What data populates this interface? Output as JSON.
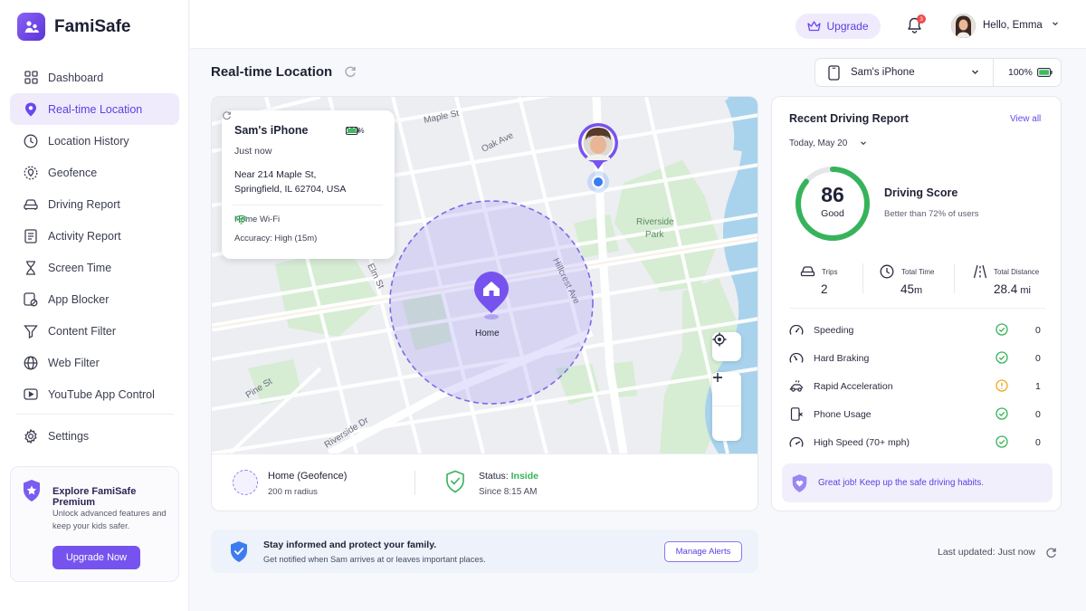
{
  "app": {
    "name": "FamiSafe"
  },
  "sidebar": {
    "items": [
      {
        "label": "Dashboard",
        "icon": "grid-icon"
      },
      {
        "label": "Real-time Location",
        "icon": "location-pin-icon",
        "active": true
      },
      {
        "label": "Location History",
        "icon": "clock-icon"
      },
      {
        "label": "Geofence",
        "icon": "geofence-icon"
      },
      {
        "label": "Driving Report",
        "icon": "car-icon"
      },
      {
        "label": "Activity Report",
        "icon": "report-icon"
      },
      {
        "label": "Screen Time",
        "icon": "hourglass-icon"
      },
      {
        "label": "App Blocker",
        "icon": "app-blocker-icon"
      },
      {
        "label": "Content Filter",
        "icon": "filter-icon"
      },
      {
        "label": "Web Filter",
        "icon": "globe-icon"
      },
      {
        "label": "YouTube App Control",
        "icon": "youtube-icon"
      }
    ],
    "settings_label": "Settings",
    "promo": {
      "title": "Explore FamiSafe Premium",
      "text": "Unlock advanced features and keep your kids safer.",
      "button": "Upgrade Now"
    }
  },
  "header": {
    "upgrade_label": "Upgrade",
    "notification_count": "3",
    "greeting": "Hello, Emma"
  },
  "page": {
    "title": "Real-time Location"
  },
  "device": {
    "name": "Sam's iPhone",
    "battery": "100%"
  },
  "info_card": {
    "device": "Sam's iPhone",
    "battery": "100%",
    "time": "Just now",
    "address_line1": "Near 214 Maple St,",
    "address_line2": "Springfield, IL 62704, USA",
    "wifi": "Home Wi-Fi",
    "accuracy": "Accuracy: High (15m)"
  },
  "map": {
    "streets": [
      "Maple St",
      "Oak Ave",
      "Elm St",
      "Hillcrest Ave",
      "Pine St",
      "Riverside Dr"
    ],
    "park": [
      "Riverside",
      "Park"
    ],
    "home_label": "Home"
  },
  "geofence": {
    "title": "Home (Geofence)",
    "radius": "200 m radius",
    "status_label": "Status:",
    "status_value": "Inside",
    "since": "Since 8:15 AM"
  },
  "alert": {
    "title": "Stay informed and protect your family.",
    "subtitle": "Get notified when Sam arrives at or leaves important places.",
    "button": "Manage Alerts"
  },
  "driving": {
    "title": "Recent Driving Report",
    "view_all": "View all",
    "date": "Today, May 20",
    "score": "86",
    "score_fraction": 0.86,
    "score_label": "Good",
    "score_title": "Driving Score",
    "score_sub": "Better than 72% of users",
    "stats": [
      {
        "label": "Trips",
        "value": "2",
        "unit": "",
        "icon": "car-icon"
      },
      {
        "label": "Total Time",
        "value": "45",
        "unit": "m",
        "icon": "clock-icon"
      },
      {
        "label": "Total Distance",
        "value": "28.4",
        "unit": " mi",
        "icon": "road-icon"
      }
    ],
    "events": [
      {
        "label": "Speeding",
        "status": "ok",
        "count": "0",
        "icon": "speedometer-icon"
      },
      {
        "label": "Hard Braking",
        "status": "ok",
        "count": "0",
        "icon": "brake-icon"
      },
      {
        "label": "Rapid Acceleration",
        "status": "warning",
        "count": "1",
        "icon": "acceleration-icon"
      },
      {
        "label": "Phone Usage",
        "status": "ok",
        "count": "0",
        "icon": "phone-usage-icon"
      },
      {
        "label": "High Speed (70+ mph)",
        "status": "ok",
        "count": "0",
        "icon": "speedometer-icon"
      }
    ],
    "note": "Great job! Keep up the safe driving habits."
  },
  "footer": {
    "last_updated": "Last updated: Just now"
  },
  "colors": {
    "accent": "#6a48ee",
    "success": "#37b35b",
    "warning": "#f0a91e",
    "geofence": "#8f7ef0"
  }
}
